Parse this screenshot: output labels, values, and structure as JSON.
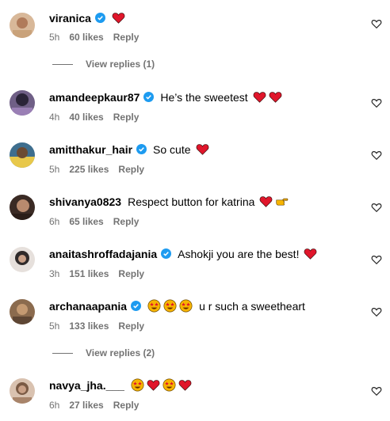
{
  "comments": [
    {
      "username": "viranica",
      "verified": true,
      "text": "",
      "emojis": [
        "heart"
      ],
      "time": "5h",
      "likes": "60 likes",
      "reply": "Reply",
      "avatar_color": "#c9a27a"
    },
    {
      "username": "amandeepkaur87",
      "verified": true,
      "text": "He’s the sweetest",
      "emojis": [
        "heart",
        "heart"
      ],
      "time": "4h",
      "likes": "40 likes",
      "reply": "Reply",
      "avatar_color": "#5b4a6e"
    },
    {
      "username": "amitthakur_hair",
      "verified": true,
      "text": "So cute",
      "emojis": [
        "heart"
      ],
      "time": "5h",
      "likes": "225 likes",
      "reply": "Reply",
      "avatar_color": "#4f7a3a"
    },
    {
      "username": "shivanya0823",
      "verified": false,
      "text": "Respect button for katrina",
      "emojis": [
        "heart",
        "point-right"
      ],
      "time": "6h",
      "likes": "65 likes",
      "reply": "Reply",
      "avatar_color": "#5a4035"
    },
    {
      "username": "anaitashroffadajania",
      "verified": true,
      "text": "Ashokji you are the best!",
      "emojis": [
        "heart"
      ],
      "time": "3h",
      "likes": "151 likes",
      "reply": "Reply",
      "avatar_color": "#2f2a2a"
    },
    {
      "username": "archanaapania",
      "verified": true,
      "text": "u r such a sweetheart",
      "emojis_before": [
        "star-eyes",
        "star-eyes",
        "star-eyes"
      ],
      "time": "5h",
      "likes": "133 likes",
      "reply": "Reply",
      "avatar_color": "#8b6b4e"
    },
    {
      "username": "navya_jha.___",
      "verified": false,
      "text": "",
      "emojis": [
        "star-eyes",
        "heart",
        "star-eyes",
        "heart"
      ],
      "time": "6h",
      "likes": "27 likes",
      "reply": "Reply",
      "avatar_color": "#a8846a"
    }
  ],
  "view_replies": [
    "View replies (1)",
    "View replies (2)"
  ],
  "colors": {
    "heart": "#e0162b",
    "verified": "#1d9bf0",
    "meta": "#737373"
  }
}
